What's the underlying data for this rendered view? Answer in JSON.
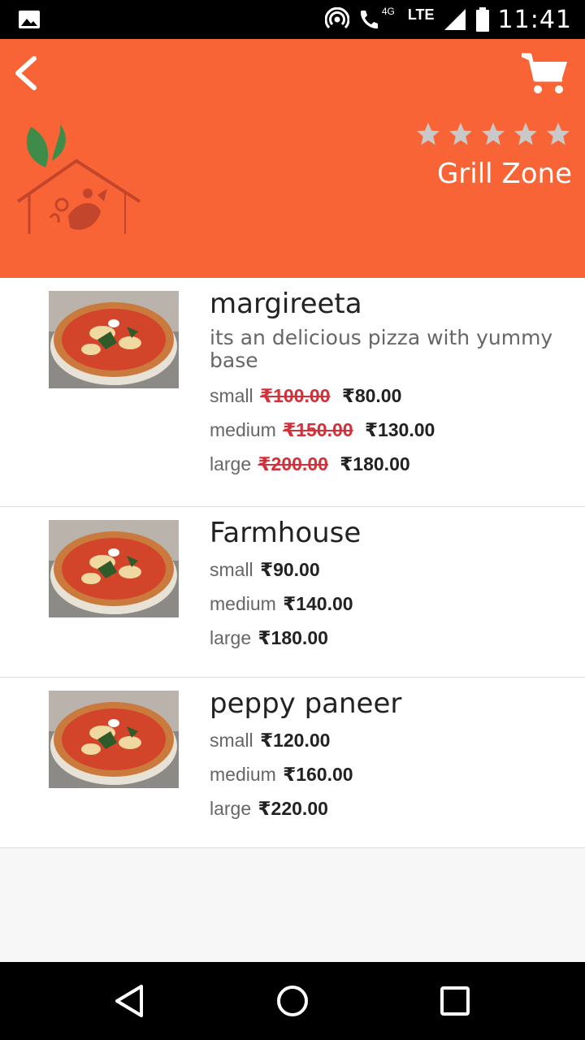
{
  "status_bar": {
    "network": "LTE",
    "network_small": "4G",
    "time": "11:41"
  },
  "header": {
    "back_icon": "chevron-left-icon",
    "cart_icon": "shopping-cart-icon",
    "restaurant_name": "Grill Zone",
    "rating_stars": 5,
    "colors": {
      "header_bg": "#f86436",
      "text": "#ffffff"
    }
  },
  "menu": {
    "items": [
      {
        "name": "margireeta",
        "description": "its an delicious pizza with yummy base",
        "prices": [
          {
            "size": "small",
            "old_price": "₹100.00",
            "price": "₹80.00"
          },
          {
            "size": "medium",
            "old_price": "₹150.00",
            "price": "₹130.00"
          },
          {
            "size": "large",
            "old_price": "₹200.00",
            "price": "₹180.00"
          }
        ]
      },
      {
        "name": "Farmhouse",
        "prices": [
          {
            "size": "small",
            "price": "₹90.00"
          },
          {
            "size": "medium",
            "price": "₹140.00"
          },
          {
            "size": "large",
            "price": "₹180.00"
          }
        ]
      },
      {
        "name": "peppy paneer",
        "prices": [
          {
            "size": "small",
            "price": "₹120.00"
          },
          {
            "size": "medium",
            "price": "₹160.00"
          },
          {
            "size": "large",
            "price": "₹220.00"
          }
        ]
      }
    ]
  },
  "nav_bar": {
    "back_icon": "triangle-back-icon",
    "home_icon": "circle-home-icon",
    "recents_icon": "square-recents-icon"
  }
}
